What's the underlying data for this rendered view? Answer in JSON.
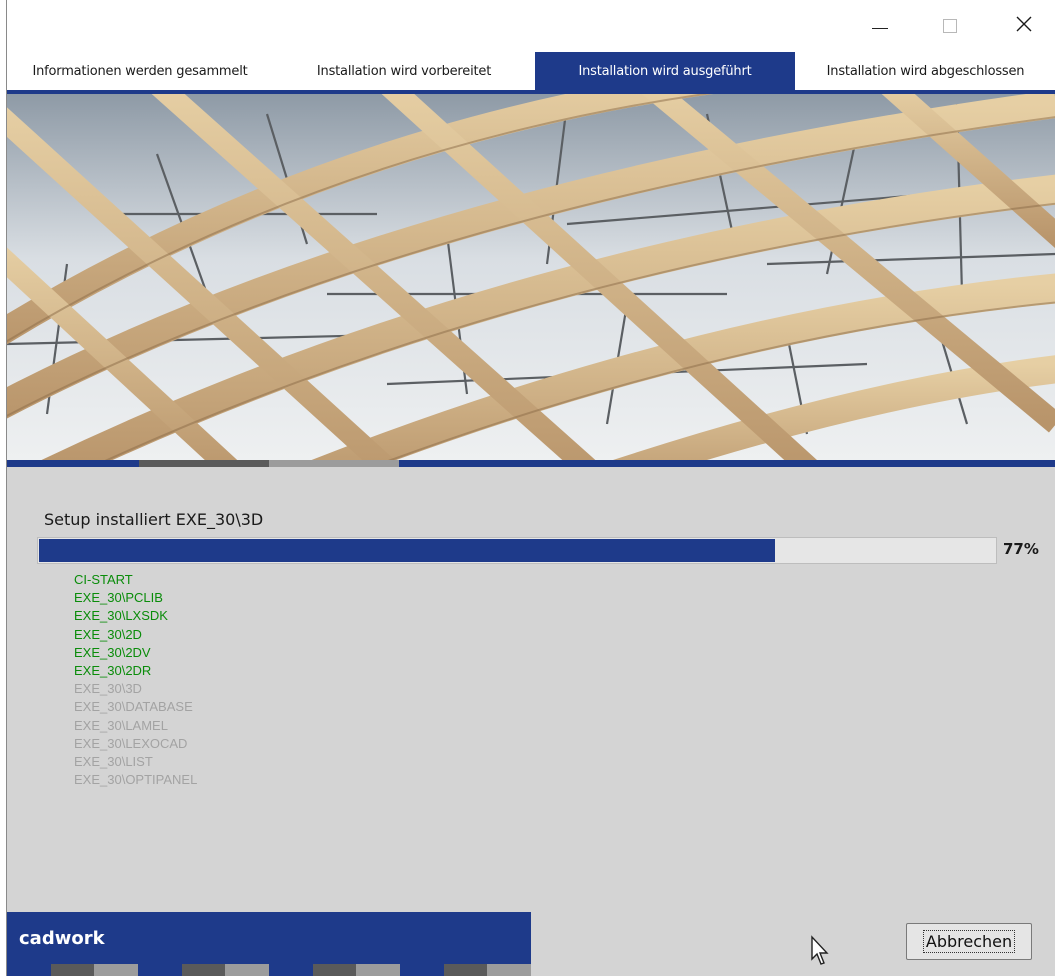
{
  "window": {
    "controls": {
      "minimize_icon": "minimize-icon",
      "maximize_icon": "maximize-icon",
      "close_icon": "close-icon"
    }
  },
  "tabs": [
    {
      "label": "Informationen werden gesammelt",
      "active": false
    },
    {
      "label": "Installation wird vorbereitet",
      "active": false
    },
    {
      "label": "Installation wird ausgeführt",
      "active": true
    },
    {
      "label": "Installation wird abgeschlossen",
      "active": false
    }
  ],
  "banner": {
    "subject": "wooden-roof-lattice-photo"
  },
  "status": {
    "label": "Setup installiert EXE_30\\3D",
    "progress_percent": 77,
    "percent_label": "77%"
  },
  "modules": [
    {
      "name": "CI-START",
      "state": "done"
    },
    {
      "name": "EXE_30\\PCLIB",
      "state": "done"
    },
    {
      "name": "EXE_30\\LXSDK",
      "state": "done"
    },
    {
      "name": "EXE_30\\2D",
      "state": "done"
    },
    {
      "name": "EXE_30\\2DV",
      "state": "done"
    },
    {
      "name": "EXE_30\\2DR",
      "state": "done"
    },
    {
      "name": "EXE_30\\3D",
      "state": "pending"
    },
    {
      "name": "EXE_30\\DATABASE",
      "state": "pending"
    },
    {
      "name": "EXE_30\\LAMEL",
      "state": "pending"
    },
    {
      "name": "EXE_30\\LEXOCAD",
      "state": "pending"
    },
    {
      "name": "EXE_30\\LIST",
      "state": "pending"
    },
    {
      "name": "EXE_30\\OPTIPANEL",
      "state": "pending"
    }
  ],
  "footer": {
    "brand": "cadwork",
    "cancel_label": "Abbrechen"
  },
  "colors": {
    "accent": "#1e3a8a",
    "done": "#0a8c0a",
    "pending": "#a3a3a3",
    "background": "#d4d4d4"
  }
}
